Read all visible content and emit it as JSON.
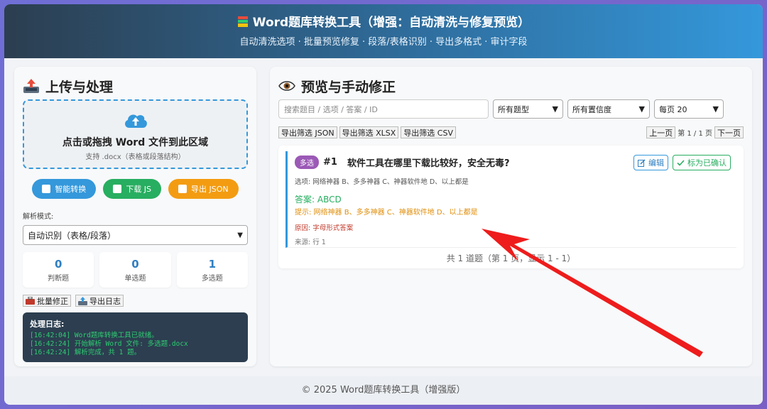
{
  "header": {
    "title": "Word题库转换工具（增强：自动清洗与修复预览）",
    "subtitle": "自动清洗选项 · 批量预览修复 · 段落/表格识别 · 导出多格式 · 审计字段"
  },
  "left": {
    "title": "上传与处理",
    "drop_main": "点击或拖拽 Word 文件到此区域",
    "drop_hint": "支持 .docx（表格或段落结构）",
    "buttons": {
      "convert": "智能转换",
      "download_js": "下载 JS",
      "export_json": "导出 JSON"
    },
    "mode_label": "解析模式:",
    "mode_value": "自动识别（表格/段落）",
    "stats": [
      {
        "num": "0",
        "label": "判断题"
      },
      {
        "num": "0",
        "label": "单选题"
      },
      {
        "num": "1",
        "label": "多选题"
      }
    ],
    "batch_fix": "批量修正",
    "export_log": "导出日志",
    "log": {
      "title": "处理日志:",
      "lines": [
        "[16:42:04] Word题库转换工具已就绪。",
        "[16:42:24] 开始解析 Word 文件: 多选题.docx",
        "[16:42:24] 解析完成，共 1 题。"
      ]
    }
  },
  "right": {
    "title": "预览与手动修正",
    "search_placeholder": "搜索题目 / 选项 / 答案 / ID",
    "type_filter": "所有题型",
    "conf_filter": "所有置信度",
    "per_page": "每页 20",
    "export": {
      "json": "导出筛选 JSON",
      "xlsx": "导出筛选 XLSX",
      "csv": "导出筛选 CSV"
    },
    "pager": {
      "prev": "上一页",
      "info": "第 1 / 1 页",
      "next": "下一页"
    },
    "question": {
      "badge": "多选",
      "num": "#1",
      "text": "软件工具在哪里下载比较好，安全无毒?",
      "edit": "编辑",
      "confirm": "标为已确认",
      "options": "选项: 网络神器 B、多多神器 C、神器软件地 D、以上都是",
      "answer": "答案: ABCD",
      "tip": "提示: 网络神器 B、多多神器 C、神器软件地 D、以上都是",
      "reason": "原因: 字母形式答案",
      "source": "来源: 行 1"
    },
    "total": "共 1 道题（第 1 页，显示 1 - 1）"
  },
  "footer": "© 2025 Word题库转换工具（增强版）",
  "colors": {
    "accent": "#3498db",
    "success": "#27ae60",
    "warning": "#f39c12",
    "purple": "#9b59b6",
    "arrow": "#ee1c1c"
  }
}
